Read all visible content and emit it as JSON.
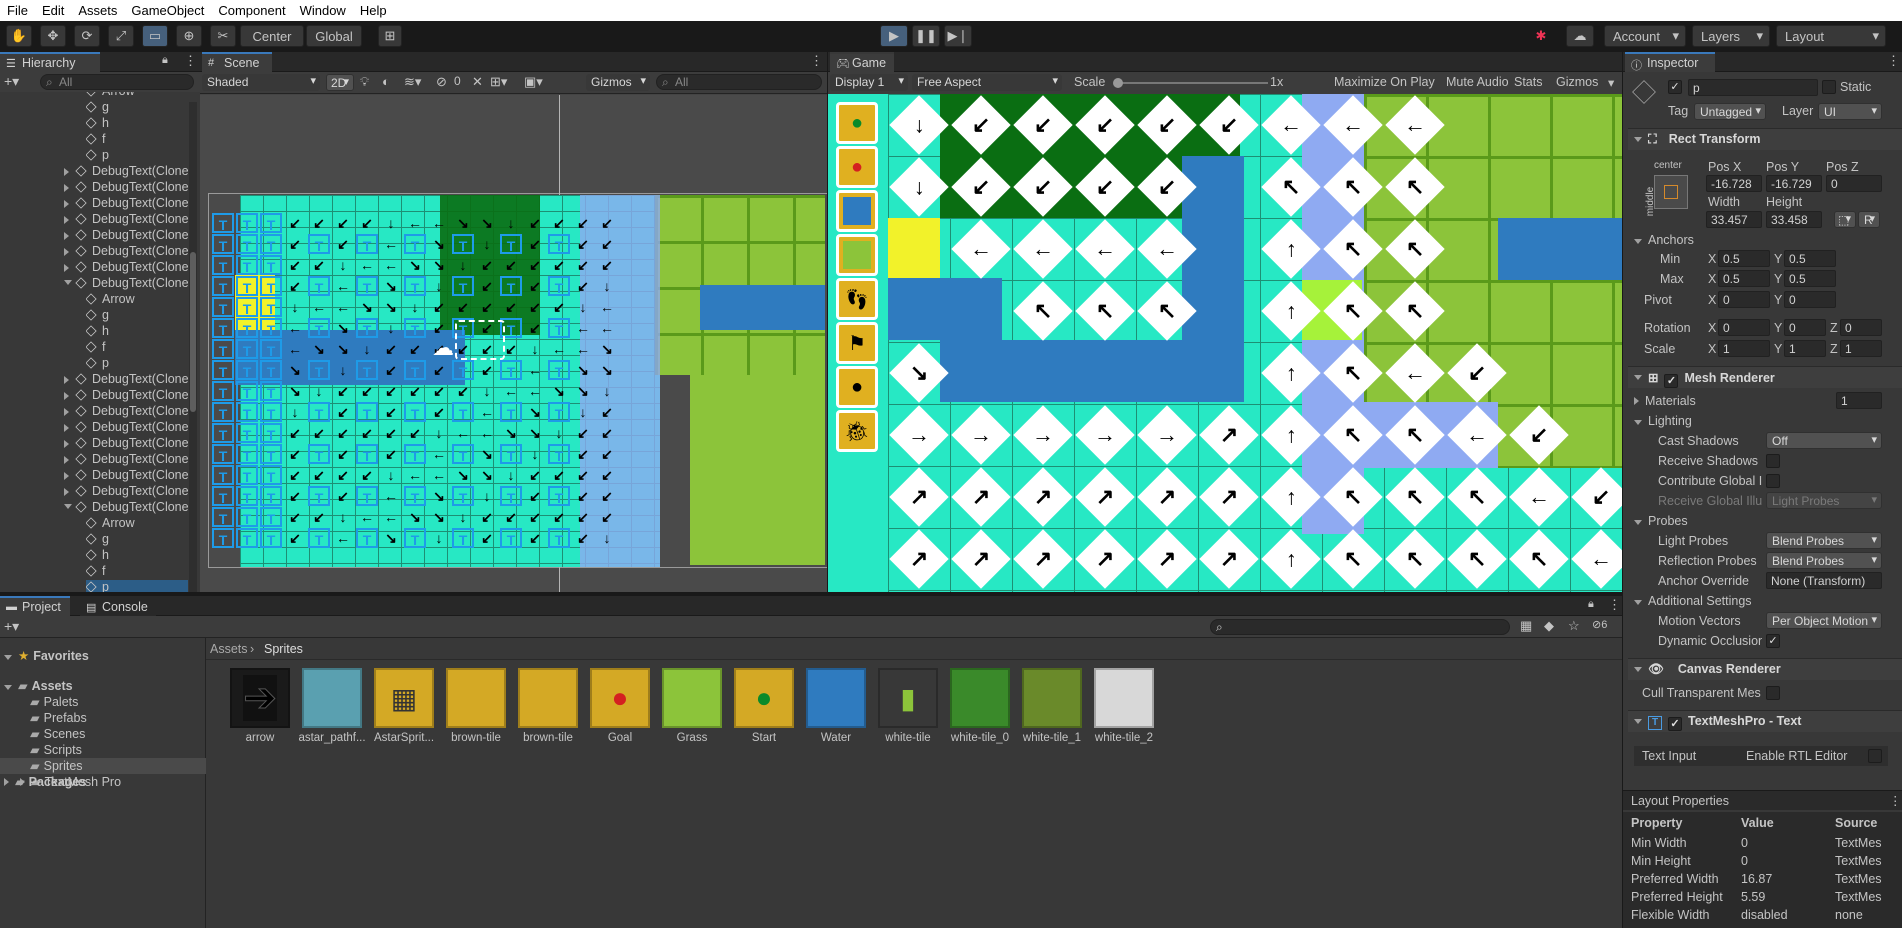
{
  "menu": [
    "File",
    "Edit",
    "Assets",
    "GameObject",
    "Component",
    "Window",
    "Help"
  ],
  "toolbar": {
    "pivot": "Center",
    "space": "Global",
    "account": "Account",
    "layers": "Layers",
    "layout": "Layout"
  },
  "hierarchy": {
    "title": "Hierarchy",
    "search_placeholder": "All",
    "items": [
      "Arrow",
      "g",
      "h",
      "f",
      "p",
      "DebugText(Clone)",
      "DebugText(Clone)",
      "DebugText(Clone)",
      "DebugText(Clone)",
      "DebugText(Clone)",
      "DebugText(Clone)",
      "DebugText(Clone)",
      "DebugText(Clone)",
      "Arrow",
      "g",
      "h",
      "f",
      "p",
      "DebugText(Clone)",
      "DebugText(Clone)",
      "DebugText(Clone)",
      "DebugText(Clone)",
      "DebugText(Clone)",
      "DebugText(Clone)",
      "DebugText(Clone)",
      "DebugText(Clone)",
      "DebugText(Clone)",
      "Arrow",
      "g",
      "h",
      "f",
      "p"
    ]
  },
  "scene": {
    "title": "Scene",
    "shading": "Shaded",
    "mode2d": "2D",
    "hidden_count": "0",
    "gizmos": "Gizmos",
    "search_placeholder": "All"
  },
  "game": {
    "title": "Game",
    "display": "Display 1",
    "aspect": "Free Aspect",
    "scale_label": "Scale",
    "scale_value": "1x",
    "maximize": "Maximize On Play",
    "mute": "Mute Audio",
    "stats": "Stats",
    "gizmos": "Gizmos"
  },
  "inspector": {
    "title": "Inspector",
    "name": "p",
    "static": "Static",
    "tag_label": "Tag",
    "tag": "Untagged",
    "layer_label": "Layer",
    "layer": "UI",
    "rect": {
      "title": "Rect Transform",
      "anchor_label": "center",
      "side_label": "middle",
      "posx_label": "Pos X",
      "posy_label": "Pos Y",
      "posz_label": "Pos Z",
      "posx": "-16.728",
      "posy": "-16.729",
      "posz": "0",
      "width_label": "Width",
      "height_label": "Height",
      "width": "33.457",
      "height": "33.458",
      "r_btn": "R",
      "anchors": "Anchors",
      "min": "Min",
      "max": "Max",
      "x": "X",
      "y": "Y",
      "z": "Z",
      "min_x": "0.5",
      "min_y": "0.5",
      "max_x": "0.5",
      "max_y": "0.5",
      "pivot": "Pivot",
      "pivot_x": "0",
      "pivot_y": "0",
      "rotation": "Rotation",
      "rot_x": "0",
      "rot_y": "0",
      "rot_z": "0",
      "scale": "Scale",
      "scale_x": "1",
      "scale_y": "1",
      "scale_z": "1"
    },
    "mesh": {
      "title": "Mesh Renderer",
      "materials": "Materials",
      "materials_count": "1",
      "lighting": "Lighting",
      "cast_shadows": "Cast Shadows",
      "cast_value": "Off",
      "receive_shadows": "Receive Shadows",
      "contribute_gi": "Contribute Global I",
      "receive_gi": "Receive Global Illu",
      "receive_gi_value": "Light Probes",
      "probes": "Probes",
      "light_probes": "Light Probes",
      "light_probes_value": "Blend Probes",
      "reflection_probes": "Reflection Probes",
      "reflection_value": "Blend Probes",
      "anchor_override": "Anchor Override",
      "anchor_value": "None (Transform)",
      "additional": "Additional Settings",
      "motion_vectors": "Motion Vectors",
      "motion_value": "Per Object Motion",
      "dynamic_occlusion": "Dynamic Occlusion"
    },
    "canvas": {
      "title": "Canvas Renderer",
      "cull": "Cull Transparent Mes"
    },
    "tmp": {
      "title": "TextMeshPro - Text",
      "text_input": "Text Input",
      "rtl": "Enable RTL Editor"
    },
    "layout": {
      "title": "Layout Properties",
      "headers": [
        "Property",
        "Value",
        "Source"
      ],
      "rows": [
        [
          "Min Width",
          "0",
          "TextMes"
        ],
        [
          "Min Height",
          "0",
          "TextMes"
        ],
        [
          "Preferred Width",
          "16.87",
          "TextMes"
        ],
        [
          "Preferred Height",
          "5.59",
          "TextMes"
        ],
        [
          "Flexible Width",
          "disabled",
          "none"
        ]
      ]
    }
  },
  "project": {
    "tab_project": "Project",
    "tab_console": "Console",
    "favorites": "Favorites",
    "assets": "Assets",
    "folders": [
      "Palets",
      "Prefabs",
      "Scenes",
      "Scripts",
      "Sprites",
      "TextMesh Pro"
    ],
    "packages": "Packages",
    "breadcrumb": [
      "Assets",
      "Sprites"
    ],
    "hidden_count": "6",
    "items": [
      "arrow",
      "astar_pathf...",
      "AstarSprit...",
      "brown-tile",
      "brown-tile",
      "Goal",
      "Grass",
      "Start",
      "Water",
      "white-tile",
      "white-tile_0",
      "white-tile_1",
      "white-tile_2"
    ]
  },
  "colors": {
    "cyan": "#27e8c4",
    "green": "#8cc43a",
    "blue": "#2f7bbf",
    "darkgreen": "#0a6e12",
    "yellow": "#d4a925",
    "accent": "#3a79bb"
  }
}
